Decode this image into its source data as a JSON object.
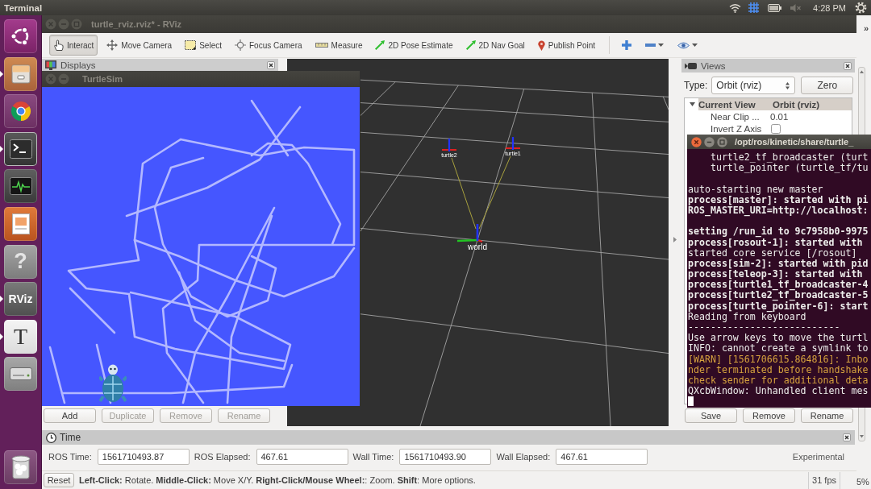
{
  "top_panel": {
    "app_title": "Terminal",
    "clock": "4:28 PM"
  },
  "launcher": [
    {
      "kind": "ubuntu",
      "running": false
    },
    {
      "kind": "files",
      "running": true
    },
    {
      "kind": "browser",
      "running": false
    },
    {
      "kind": "terminal",
      "running": true
    },
    {
      "kind": "monitor",
      "running": false
    },
    {
      "kind": "slides",
      "running": false
    },
    {
      "kind": "help",
      "glyph": "?",
      "running": false
    },
    {
      "kind": "rviz",
      "glyph": "RViz",
      "running": true
    },
    {
      "kind": "text",
      "glyph": "T",
      "running": true
    },
    {
      "kind": "drive",
      "running": false
    },
    {
      "kind": "trash",
      "running": false
    }
  ],
  "rviz": {
    "title": "turtle_rviz.rviz* - RViz",
    "tools": [
      {
        "kind": "interact",
        "label": "Interact",
        "selected": true
      },
      {
        "kind": "move_camera",
        "label": "Move Camera",
        "selected": false
      },
      {
        "kind": "select",
        "label": "Select",
        "selected": false
      },
      {
        "kind": "focus_camera",
        "label": "Focus Camera",
        "selected": false
      },
      {
        "kind": "measure",
        "label": "Measure",
        "selected": false
      },
      {
        "kind": "pose_estimate",
        "label": "2D Pose Estimate",
        "selected": false
      },
      {
        "kind": "nav_goal",
        "label": "2D Nav Goal",
        "selected": false
      },
      {
        "kind": "publish_point",
        "label": "Publish Point",
        "selected": false
      }
    ],
    "displays_panel": {
      "title": "Displays",
      "buttons": [
        {
          "label": "Add",
          "disabled": false
        },
        {
          "label": "Duplicate",
          "disabled": true
        },
        {
          "label": "Remove",
          "disabled": true
        },
        {
          "label": "Rename",
          "disabled": true
        }
      ]
    },
    "view_3d": {
      "frames": [
        {
          "kind": "child",
          "label": "turtle2"
        },
        {
          "kind": "child",
          "label": "turtle1"
        },
        {
          "kind": "root",
          "label": "world"
        }
      ]
    },
    "views_panel": {
      "title": "Views",
      "type_label": "Type:",
      "type_value": "Orbit (rviz)",
      "zero_button": "Zero",
      "tree": {
        "name": "Current View",
        "value": "Orbit (rviz)",
        "expanded": true,
        "children": [
          {
            "kind": "value",
            "name": "Near Clip ...",
            "value": "0.01"
          },
          {
            "kind": "checkbox",
            "name": "Invert Z Axis",
            "checked": false
          }
        ]
      },
      "buttons": [
        {
          "label": "Save",
          "disabled": false
        },
        {
          "label": "Remove",
          "disabled": false
        },
        {
          "label": "Rename",
          "disabled": false
        }
      ]
    },
    "time_panel": {
      "title": "Time",
      "fields": [
        {
          "label": "ROS Time:",
          "value": "1561710493.87"
        },
        {
          "label": "ROS Elapsed:",
          "value": "467.61"
        },
        {
          "label": "Wall Time:",
          "value": "1561710493.90"
        },
        {
          "label": "Wall Elapsed:",
          "value": "467.61"
        }
      ],
      "experimental_label": "Experimental"
    },
    "status_bar": {
      "reset_button": "Reset",
      "hint": "**Left-Click:** Rotate. **Middle-Click:** Move X/Y. **Right-Click/Mouse Wheel:**: Zoom. **Shift**: More options.",
      "fps": "31 fps"
    }
  },
  "turtlesim": {
    "title": "TurtleSim"
  },
  "terminal": {
    "title": "/opt/ros/kinetic/share/turtle_",
    "lines": [
      {
        "kind": "plain",
        "text": "    turtle2_tf_broadcaster (turt"
      },
      {
        "kind": "plain",
        "text": "    turtle_pointer (turtle_tf/tu"
      },
      {
        "kind": "blank"
      },
      {
        "kind": "plain",
        "text": "auto-starting new master"
      },
      {
        "kind": "bold",
        "text": "process[master]: started with pi"
      },
      {
        "kind": "bold",
        "text": "ROS_MASTER_URI=http://localhost:"
      },
      {
        "kind": "blank"
      },
      {
        "kind": "bold",
        "text": "setting /run_id to 9c7958b0-9975"
      },
      {
        "kind": "bold",
        "text": "process[rosout-1]: started with"
      },
      {
        "kind": "plain",
        "text": "started core service [/rosout]"
      },
      {
        "kind": "bold",
        "text": "process[sim-2]: started with pid"
      },
      {
        "kind": "bold",
        "text": "process[teleop-3]: started with"
      },
      {
        "kind": "bold",
        "text": "process[turtle1_tf_broadcaster-4"
      },
      {
        "kind": "bold",
        "text": "process[turtle2_tf_broadcaster-5"
      },
      {
        "kind": "bold",
        "text": "process[turtle_pointer-6]: start"
      },
      {
        "kind": "plain",
        "text": "Reading from keyboard"
      },
      {
        "kind": "plain",
        "text": "---------------------------"
      },
      {
        "kind": "plain",
        "text": "Use arrow keys to move the turtl"
      },
      {
        "kind": "plain",
        "text": "INFO: cannot create a symlink to"
      },
      {
        "kind": "warn",
        "text": "[WARN] [1561706615.864816]: Inbo"
      },
      {
        "kind": "warn",
        "text": "nder terminated before handshake"
      },
      {
        "kind": "warn",
        "text": "check sender for additional deta"
      },
      {
        "kind": "plain",
        "text": "QXcbWindow: Unhandled client mes"
      }
    ]
  },
  "edge_window": {
    "chevron": "»",
    "status_text": "5%"
  }
}
